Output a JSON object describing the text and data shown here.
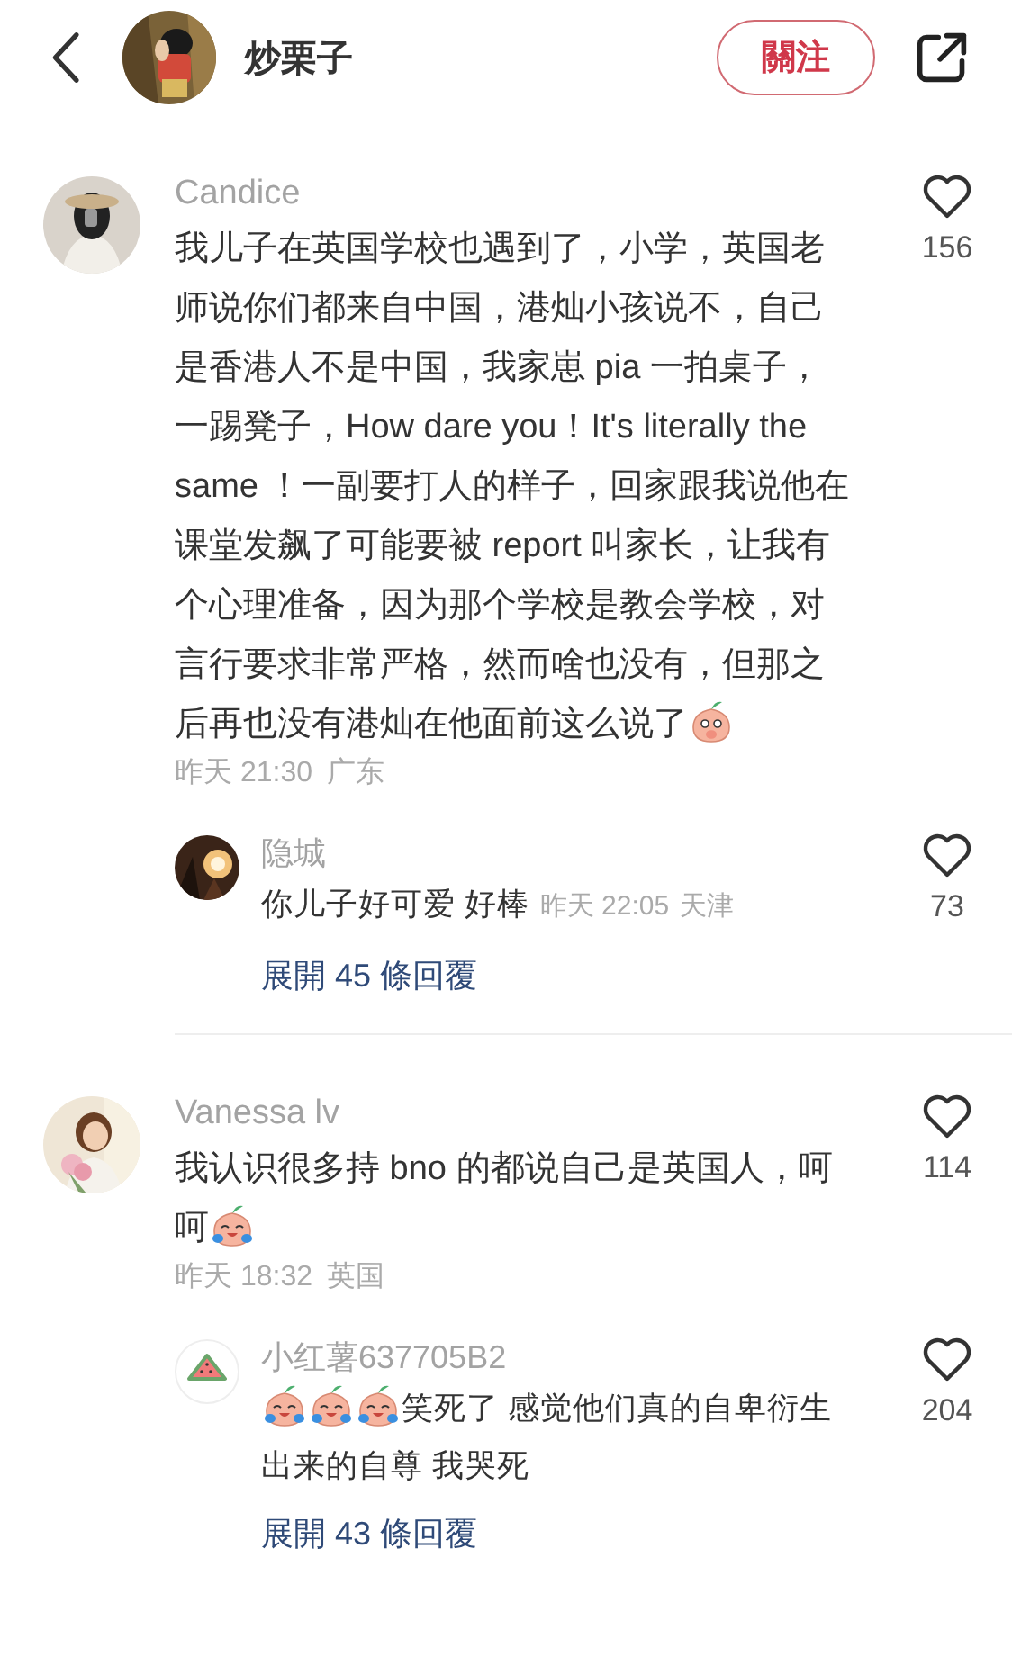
{
  "header": {
    "author": "炒栗子",
    "follow_label": "關注"
  },
  "comments": [
    {
      "avatar": {
        "kind": "picture"
      },
      "name": "Candice",
      "content": [
        {
          "kind": "text",
          "text": "我儿子在英国学校也遇到了，小学，英国老师说你们都来自中国，港灿小孩说不，自己是香港人不是中国，我家崽 pia 一拍桌子，一踢凳子，How dare you！It's literally the same ！一副要打人的样子，回家跟我说他在课堂发飙了可能要被 report 叫家长，让我有个心理准备，因为那个学校是教会学校，对言行要求非常严格，然而啥也没有，但那之后再也没有港灿在他面前这么说了"
        },
        {
          "kind": "sticker-shy"
        }
      ],
      "time": "昨天 21:30",
      "location": "广东",
      "likes": "156",
      "replies": [
        {
          "avatar": {
            "kind": "picture"
          },
          "name": "隐城",
          "content": [
            {
              "kind": "text",
              "text": "你儿子好可爱 好棒"
            }
          ],
          "time": "昨天 22:05",
          "location": "天津",
          "likes": "73"
        }
      ],
      "expand": "展開 45 條回覆"
    },
    {
      "avatar": {
        "kind": "picture"
      },
      "name": "Vanessa lv",
      "content": [
        {
          "kind": "text",
          "text": "我认识很多持 bno 的都说自己是英国人，呵呵"
        },
        {
          "kind": "sticker-laugh"
        }
      ],
      "time": "昨天 18:32",
      "location": "英国",
      "likes": "114",
      "replies": [
        {
          "avatar": {
            "kind": "watermelon"
          },
          "name": "小红薯637705B2",
          "content": [
            {
              "kind": "sticker-laugh"
            },
            {
              "kind": "sticker-laugh"
            },
            {
              "kind": "sticker-laugh"
            },
            {
              "kind": "text",
              "text": "笑死了 感觉他们真的自卑衍生出来的自尊 我哭死"
            }
          ],
          "likes": "204"
        }
      ],
      "expand": "展開 43 條回覆"
    }
  ]
}
